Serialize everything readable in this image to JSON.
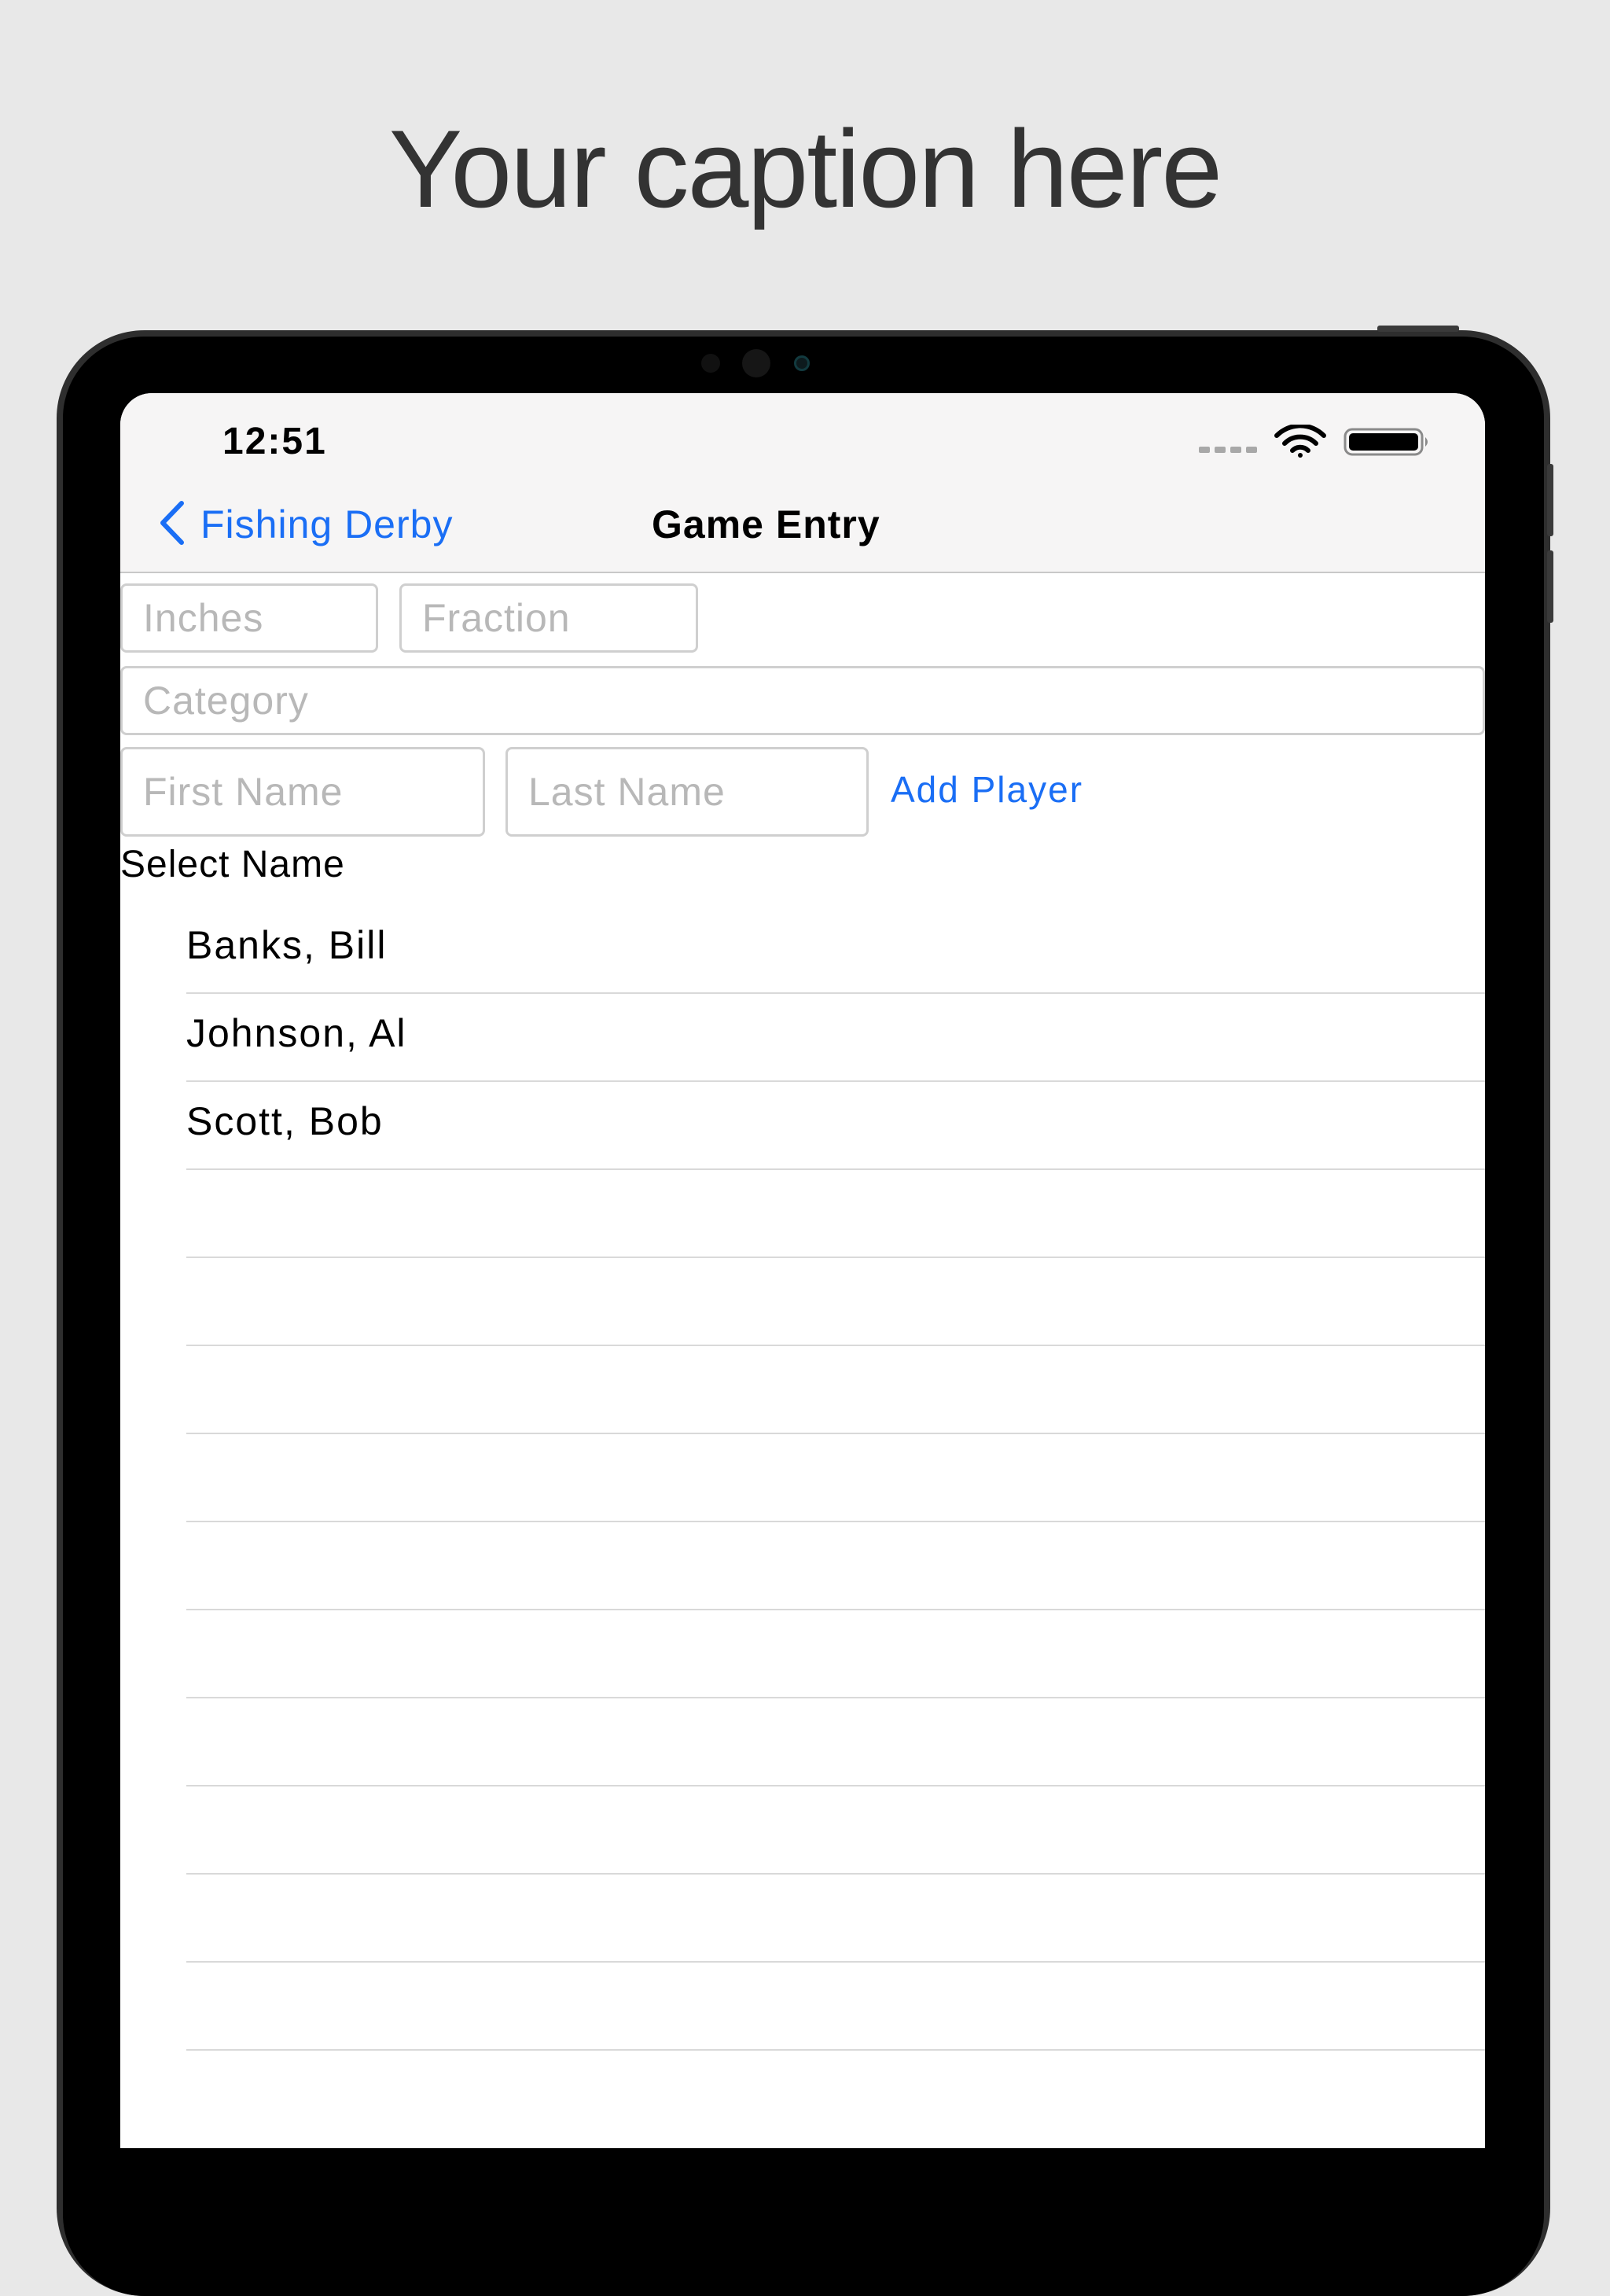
{
  "caption": "Your caption here",
  "status_bar": {
    "time": "12:51",
    "icons": [
      "cellular-dots-icon",
      "wifi-icon",
      "battery-icon"
    ]
  },
  "nav": {
    "back_label": "Fishing Derby",
    "title": "Game Entry"
  },
  "form": {
    "inches_placeholder": "Inches",
    "fraction_placeholder": "Fraction",
    "category_placeholder": "Category",
    "first_name_placeholder": "First Name",
    "last_name_placeholder": "Last Name",
    "add_player_label": "Add Player"
  },
  "player_list": {
    "header": "Select Name",
    "players": [
      "Banks, Bill",
      "Johnson, Al",
      "Scott, Bob"
    ]
  },
  "colors": {
    "accent": "#1a6ef5",
    "background": "#e8e8e8",
    "caption_text": "#333333"
  }
}
